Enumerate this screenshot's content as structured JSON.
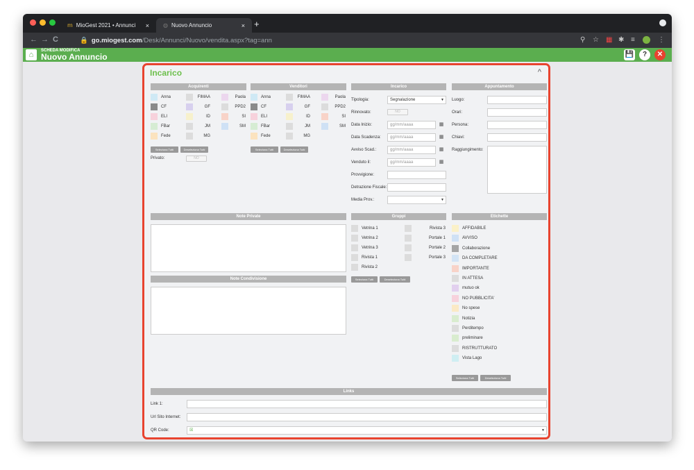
{
  "browser": {
    "tabs": [
      {
        "label": "MioGest 2021 • Annunci",
        "close": "×"
      },
      {
        "label": "Nuovo Annuncio",
        "close": "×"
      }
    ],
    "new_tab": "+",
    "url_domain": "go.miogest.com",
    "url_path": "/Desk/Annunci/Nuovo/vendita.aspx?tag=ann",
    "nav": {
      "back": "←",
      "forward": "→",
      "reload": "C"
    }
  },
  "app": {
    "subtitle": "SCHEDA MODIFICA",
    "title": "Nuovo Annuncio",
    "save_icon": "💾",
    "help_icon": "?",
    "close_icon": "✕",
    "home_icon": "⌂"
  },
  "panel": {
    "title": "Incarico",
    "collapse": "^"
  },
  "colors": {
    "accent_green": "#5bae4f",
    "title_green": "#6cbf4b",
    "panel_border": "#e8432f",
    "header_gray": "#b4b4b4"
  },
  "acquirenti": {
    "header": "Acquirenti",
    "col1": [
      {
        "label": "Anna",
        "color": "#cfe9f5"
      },
      {
        "label": "CF",
        "color": "#8a8a8a"
      },
      {
        "label": "ELI",
        "color": "#f7d2dc"
      },
      {
        "label": "FBar",
        "color": "#d6ecd3"
      },
      {
        "label": "Fede",
        "color": "#fbe3bf"
      }
    ],
    "col2": [
      {
        "label": "FIMAA",
        "color": "#dcdcdc"
      },
      {
        "label": "GF",
        "color": "#d7d0ee"
      },
      {
        "label": "ID",
        "color": "#f7f1cc"
      },
      {
        "label": "JM",
        "color": "#dcdcdc"
      },
      {
        "label": "MG",
        "color": "#dcdcdc"
      }
    ],
    "col3": [
      {
        "label": "Paola",
        "color": "#ecd7ee"
      },
      {
        "label": "PPD2",
        "color": "#dcdcdc"
      },
      {
        "label": "SI",
        "color": "#f8d3c8"
      },
      {
        "label": "SM",
        "color": "#cfe1f5"
      }
    ],
    "select_all": "Seleziona Tutti",
    "deselect_all": "Deseleziona Tutti",
    "private_label": "Privato:",
    "private_value": "NO"
  },
  "venditori": {
    "header": "Venditori",
    "col1": [
      {
        "label": "Anna",
        "color": "#cfe9f5"
      },
      {
        "label": "CF",
        "color": "#8a8a8a"
      },
      {
        "label": "ELI",
        "color": "#f7d2dc"
      },
      {
        "label": "FBar",
        "color": "#d6ecd3"
      },
      {
        "label": "Fede",
        "color": "#fbe3bf"
      }
    ],
    "col2": [
      {
        "label": "FIMAA",
        "color": "#dcdcdc"
      },
      {
        "label": "GF",
        "color": "#d7d0ee"
      },
      {
        "label": "ID",
        "color": "#f7f1cc"
      },
      {
        "label": "JM",
        "color": "#dcdcdc"
      },
      {
        "label": "MG",
        "color": "#dcdcdc"
      }
    ],
    "col3": [
      {
        "label": "Paola",
        "color": "#ecd7ee"
      },
      {
        "label": "PPD2",
        "color": "#dcdcdc"
      },
      {
        "label": "SI",
        "color": "#f8d3c8"
      },
      {
        "label": "SM",
        "color": "#cfe1f5"
      }
    ],
    "select_all": "Seleziona Tutti",
    "deselect_all": "Deseleziona Tutti"
  },
  "incarico": {
    "header": "Incarico",
    "tipologia_label": "Tipologia:",
    "tipologia_value": "Segnalazione",
    "rinnovato_label": "Rinnovato:",
    "rinnovato_value": "NO",
    "data_inizio_label": "Data Inizio:",
    "data_scadenza_label": "Data Scadenza:",
    "avviso_label": "Avviso Scad.:",
    "venduto_label": "Venduto il:",
    "date_placeholder": "gg/mm/aaaa",
    "provvigione_label": "Provvigione:",
    "detrazione_label": "Detrazione Fiscale:",
    "media_label": "Media Prov.:"
  },
  "appuntamento": {
    "header": "Appuntamento",
    "luogo": "Luogo:",
    "orari": "Orari:",
    "persona": "Persona:",
    "chiavi": "Chiavi:",
    "raggiungimento": "Raggiungimento:"
  },
  "note_private": {
    "header": "Note Private"
  },
  "note_condivisione": {
    "header": "Note Condivisione"
  },
  "gruppi": {
    "header": "Gruppi",
    "col1": [
      "Vetrina 1",
      "Vetrina 2",
      "Vetrina 3",
      "Rivista 1",
      "Rivista 2"
    ],
    "col2": [
      "Rivista 3",
      "Portale 1",
      "Portale 2",
      "Portale 3"
    ],
    "select_all": "Seleziona Tutti",
    "deselect_all": "Deseleziona Tutti"
  },
  "etichette": {
    "header": "Etichette",
    "items": [
      {
        "label": "AFFIDABILE",
        "color": "#fbf1c8"
      },
      {
        "label": "AVVISO",
        "color": "#cfe1f5"
      },
      {
        "label": "Collaborazione",
        "color": "#a5a5a5"
      },
      {
        "label": "DA COMPLETARE",
        "color": "#d3e4f5"
      },
      {
        "label": "IMPORTANTE",
        "color": "#f8d3c8"
      },
      {
        "label": "IN ATTESA",
        "color": "#dcdcdc"
      },
      {
        "label": "mutuo ok",
        "color": "#e2d0ee"
      },
      {
        "label": "NO PUBBLICITA'",
        "color": "#f7d2dc"
      },
      {
        "label": "No spese",
        "color": "#fbe9c5"
      },
      {
        "label": "Notizia",
        "color": "#d9eccf"
      },
      {
        "label": "Perditempo",
        "color": "#dcdcdc"
      },
      {
        "label": "preliminare",
        "color": "#d9eccf"
      },
      {
        "label": "RISTRUTTURATO",
        "color": "#dcdcdc"
      },
      {
        "label": "Vista Lago",
        "color": "#cfeef2"
      }
    ],
    "select_all": "Seleziona Tutti",
    "deselect_all": "Deseleziona Tutti"
  },
  "links": {
    "header": "Links",
    "link1": "Link 1:",
    "url_sito": "Url Sito Internet:",
    "qr_code": "QR Code:",
    "qr_value": "☒"
  }
}
